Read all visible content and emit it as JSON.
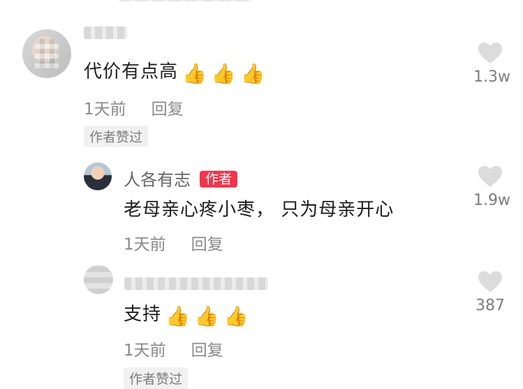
{
  "colors": {
    "author_badge": "#f2354c",
    "heart": "#dcdcdc",
    "meta_text": "#8a8a8a",
    "tag_bg": "#f1f1f1"
  },
  "comments": [
    {
      "text": "代价有点高",
      "emojis": [
        "👍",
        "👍",
        "👍"
      ],
      "time": "1天前",
      "reply_label": "回复",
      "tag": "作者赞过",
      "likes": "1.3w"
    },
    {
      "username": "人各有志",
      "badge": "作者",
      "text": "老母亲心疼小枣， 只为母亲开心",
      "time": "1天前",
      "reply_label": "回复",
      "likes": "1.9w"
    },
    {
      "text": "支持",
      "emojis": [
        "👍",
        "👍",
        "👍"
      ],
      "time": "1天前",
      "reply_label": "回复",
      "tag": "作者赞过",
      "likes": "387"
    }
  ]
}
